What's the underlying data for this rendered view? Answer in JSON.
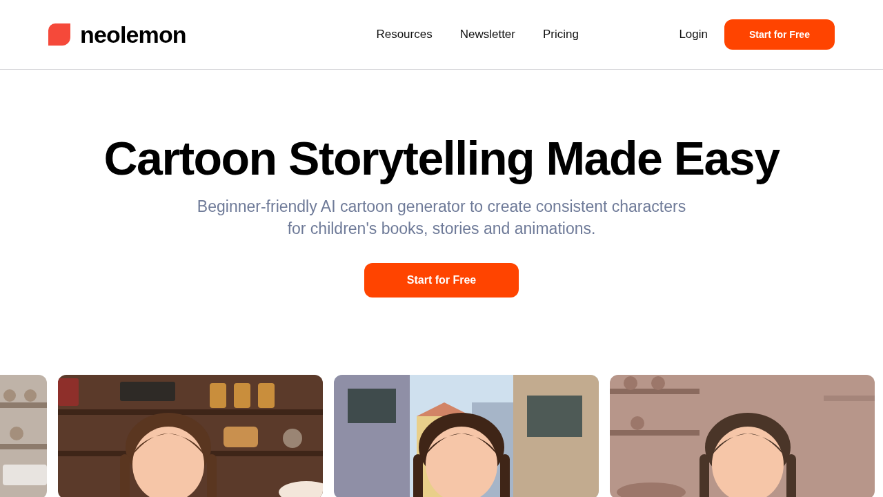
{
  "header": {
    "logo_text": "neolemon",
    "nav": [
      {
        "label": "Resources"
      },
      {
        "label": "Newsletter"
      },
      {
        "label": "Pricing"
      }
    ],
    "login": "Login",
    "cta": "Start for Free"
  },
  "hero": {
    "title": "Cartoon Storytelling Made Easy",
    "subtitle": "Beginner-friendly AI cartoon generator to create consistent characters for children's books, stories and animations.",
    "cta": "Start for Free"
  }
}
